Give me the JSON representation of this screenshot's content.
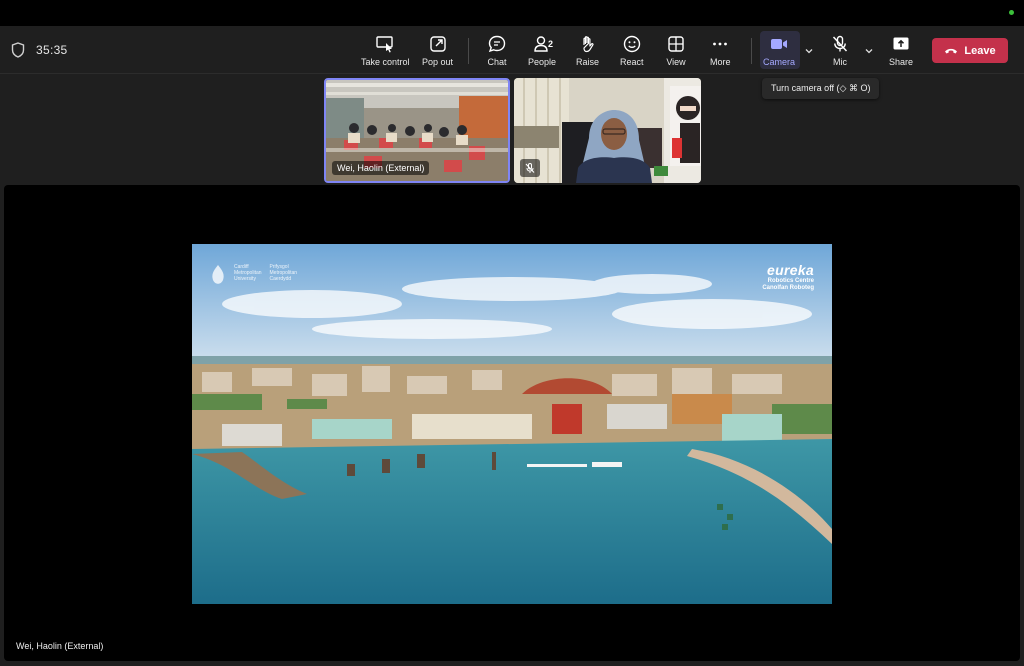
{
  "meeting": {
    "timer": "35:35"
  },
  "toolbar": {
    "take_control": "Take control",
    "pop_out": "Pop out",
    "chat": "Chat",
    "people": "People",
    "people_count": "2",
    "raise": "Raise",
    "react": "React",
    "view": "View",
    "more": "More",
    "camera": "Camera",
    "mic": "Mic",
    "share": "Share",
    "leave": "Leave"
  },
  "tooltip": {
    "camera": "Turn camera off (◇ ⌘ O)"
  },
  "participants": [
    {
      "name": "Wei, Haolin (External)",
      "speaking": true
    },
    {
      "name": "",
      "muted": true
    }
  ],
  "shared_screen": {
    "presenter": "Wei, Haolin (External)",
    "slide": {
      "logo_left_line1": [
        "Cardiff",
        "Metropolitan",
        "University"
      ],
      "logo_left_line2": [
        "Prifysgol",
        "Metropolitan",
        "Caerdydd"
      ],
      "logo_right_title": "eureka",
      "logo_right_sub1": "Robotics Centre",
      "logo_right_sub2": "Canolfan Roboteg"
    }
  },
  "colors": {
    "accent": "#7f85f5",
    "leave": "#c4314b",
    "online": "#3cc13b",
    "toolbar_bg": "#1f1f1f"
  }
}
